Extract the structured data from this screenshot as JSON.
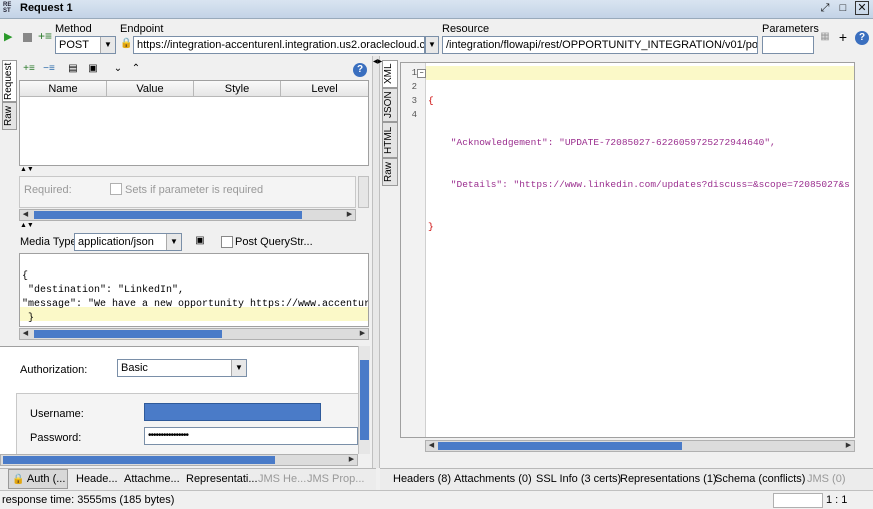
{
  "window": {
    "title": "Request 1",
    "logo": "RE ST"
  },
  "toolbar": {
    "method_label": "Method",
    "method_value": "POST",
    "endpoint_label": "Endpoint",
    "endpoint_value": "https://integration-accenturenl.integration.us2.oraclecloud.com",
    "resource_label": "Resource",
    "resource_value": "/integration/flowapi/rest/OPPORTUNITY_INTEGRATION/v01/postopp",
    "parameters_label": "Parameters",
    "parameters_value": ""
  },
  "left_tabs": [
    "Request",
    "Raw"
  ],
  "params_table": {
    "headers": [
      "Name",
      "Value",
      "Style",
      "Level"
    ]
  },
  "required": {
    "label": "Required:",
    "checkbox_label": "Sets if parameter is required"
  },
  "media": {
    "label": "Media Type",
    "value": "application/json",
    "post_query": "Post QueryStr..."
  },
  "request_body": [
    "{",
    " \"destination\": \"LinkedIn\",",
    "\"message\": \"We have a new opportunity https://www.accenture",
    " }"
  ],
  "auth": {
    "label": "Authorization:",
    "value": "Basic",
    "username_label": "Username:",
    "password_label": "Password:",
    "password_value": "••••••••••••••••"
  },
  "left_bottom_tabs": [
    "Auth (...",
    "Heade...",
    "Attachme...",
    "Representati...",
    "JMS He...",
    "JMS Prop..."
  ],
  "right_tabs": [
    "XML",
    "JSON",
    "HTML",
    "Raw"
  ],
  "response": {
    "line_numbers": [
      "1",
      "2",
      "3",
      "4"
    ],
    "lines": [
      "{",
      "    \"Acknowledgement\": \"UPDATE-72085027-6226059725272944640\",",
      "    \"Details\": \"https://www.linkedin.com/updates?discuss=&scope=72085027&s",
      "}"
    ]
  },
  "right_bottom_tabs": [
    "Headers (8)",
    "Attachments (0)",
    "SSL Info (3 certs)",
    "Representations (1)",
    "Schema (conflicts)",
    "JMS (0)"
  ],
  "status": {
    "text": "response time: 3555ms (185 bytes)",
    "position": "1 : 1"
  },
  "colors": {
    "accent": "#4a7bc8",
    "highlight": "#fbf9c8",
    "json_key": "#9b2f8f"
  }
}
